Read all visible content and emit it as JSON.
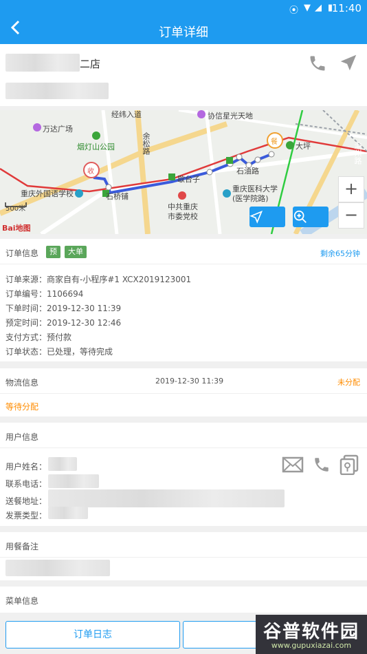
{
  "status_bar": {
    "time": "11:40"
  },
  "header": {
    "title": "订单详细"
  },
  "store": {
    "name_suffix": "二店"
  },
  "map": {
    "labels": {
      "jingwei": "经纬入道",
      "xiecheng": "协信星光天地",
      "wanda": "万达广场",
      "yandeng": "烟灯山公园",
      "yusong": "余松路",
      "dayang": "大坪",
      "shiyoulu": "石油路",
      "shiqiaopu": "石桥铺",
      "xuefu": "歇台子",
      "waiyu": "重庆外国语学校",
      "yike": "重庆医科大学\n(医学院路)",
      "dangxiao": "中共重庆\n市委党校",
      "scale": "500米",
      "logo": "Bai地图",
      "yuzhou": "渝州路",
      "start_marker": "收",
      "end_marker": "餐"
    },
    "route_color": "#3b5bdb"
  },
  "order": {
    "section_label": "订单信息",
    "tag_pre": "预",
    "tag_big": "大单",
    "remaining": "剩余65分钟",
    "lines": [
      "订单来源：商家自有-小程序#1  XCX2019123001",
      "订单编号：1106694",
      "下单时间：2019-12-30 11:39",
      "预定时间：2019-12-30 12:46",
      "支付方式：预付款",
      "订单状态：已处理，等待完成"
    ]
  },
  "logistics": {
    "section_label": "物流信息",
    "time": "2019-12-30 11:39",
    "status": "未分配",
    "detail": "等待分配"
  },
  "user": {
    "section_label": "用户信息",
    "fields": [
      "用户姓名：",
      "联系电话：",
      "送餐地址：",
      "发票类型："
    ]
  },
  "remark": {
    "section_label": "用餐备注"
  },
  "menu": {
    "section_label": "菜单信息"
  },
  "footer": {
    "log_button": "订单日志"
  },
  "watermark": {
    "brand": "谷普软件园",
    "url": "www.gupuxiazai.com"
  },
  "colors": {
    "primary": "#1e9bf0",
    "accent_orange": "#ff8c00",
    "tag_green": "#5aa65a"
  }
}
